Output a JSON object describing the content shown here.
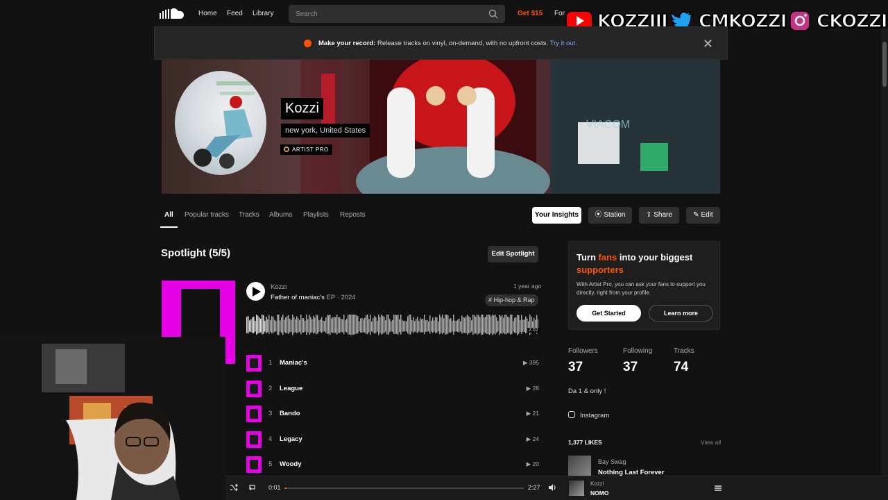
{
  "nav": {
    "home": "Home",
    "feed": "Feed",
    "library": "Library",
    "search_placeholder": "Search",
    "get15": "Get $15",
    "for": "For"
  },
  "social": {
    "youtube": "KOZZIII",
    "twitter": "CMKOZZI",
    "instagram": "CKOZZI"
  },
  "notice": {
    "bold": "Make your record:",
    "text": " Release tracks on vinyl, on-demand, with no upfront costs. ",
    "link": "Try it out."
  },
  "profile": {
    "name": "Kozzi",
    "location": "new york, United States",
    "badge": "ARTIST PRO"
  },
  "tabs": [
    "All",
    "Popular tracks",
    "Tracks",
    "Albums",
    "Playlists",
    "Reposts"
  ],
  "actions": {
    "insights": "Your Insights",
    "station": "Station",
    "share": "Share",
    "edit": "Edit"
  },
  "spotlight": {
    "title": "Spotlight (5/5)",
    "edit": "Edit Spotlight",
    "artist": "Kozzi",
    "release_title": "Father of maniac's",
    "release_meta": " EP · 2024",
    "date": "1 year ago",
    "tag": "# Hip-hop & Rap",
    "duration": "2:02",
    "tracks": [
      {
        "num": "1",
        "name": "Maniac's",
        "plays": "395"
      },
      {
        "num": "2",
        "name": "League",
        "plays": "28"
      },
      {
        "num": "3",
        "name": "Bando",
        "plays": "21"
      },
      {
        "num": "4",
        "name": "Legacy",
        "plays": "24"
      },
      {
        "num": "5",
        "name": "Woody",
        "plays": "20"
      }
    ]
  },
  "promo": {
    "h_pre": "Turn ",
    "h_accent": "fans",
    "h_mid": " into your biggest ",
    "h_accent2": "supporters",
    "desc": "With Artist Pro, you can ask your fans to support you directly, right from your profile.",
    "get_started": "Get Started",
    "learn_more": "Learn more"
  },
  "stats": {
    "followers_label": "Followers",
    "followers": "37",
    "following_label": "Following",
    "following": "37",
    "tracks_label": "Tracks",
    "tracks": "74"
  },
  "bio": "Da 1 & only !",
  "instagram_link": "Instagram",
  "likes": {
    "count_label": "1,377 LIKES",
    "view_all": "View all",
    "artist": "Bay Swag",
    "title": "Nothing Last Forever"
  },
  "player": {
    "elapsed": "0:01",
    "total": "2:27",
    "progress": 0.01,
    "artist": "Kozzi",
    "title": "NOMO"
  },
  "colors": {
    "accent": "#ff5500",
    "cover": "#e600e6",
    "bg": "#121212"
  }
}
